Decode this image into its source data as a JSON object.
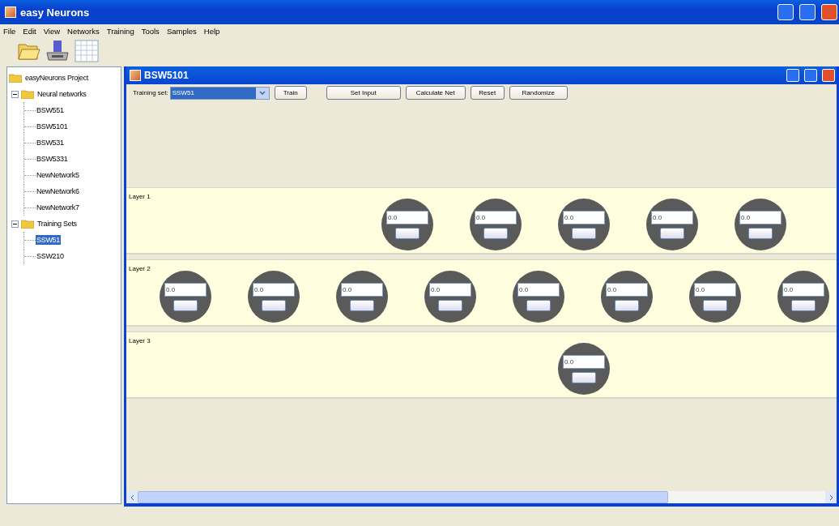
{
  "window": {
    "title": "easy Neurons"
  },
  "menu": [
    "File",
    "Edit",
    "View",
    "Networks",
    "Training",
    "Tools",
    "Samples",
    "Help"
  ],
  "toolbar": [
    {
      "kind": "open"
    },
    {
      "kind": "save"
    },
    {
      "kind": "table"
    }
  ],
  "tree": {
    "label": "easyNeurons Project",
    "children": [
      {
        "label": "Neural networks",
        "expanded": true,
        "selected": false,
        "children": [
          {
            "label": "BSW551",
            "selected": false
          },
          {
            "label": "BSW5101",
            "selected": false
          },
          {
            "label": "BSW531",
            "selected": false
          },
          {
            "label": "BSW5331",
            "selected": false
          },
          {
            "label": "NewNetwork5",
            "selected": false
          },
          {
            "label": "NewNetwork6",
            "selected": false
          },
          {
            "label": "NewNetwork7",
            "selected": false
          }
        ]
      },
      {
        "label": "Training Sets",
        "expanded": true,
        "selected": false,
        "children": [
          {
            "label": "SSW51",
            "selected": true
          },
          {
            "label": "SSW210",
            "selected": false
          }
        ]
      }
    ]
  },
  "frame": {
    "title": "BSW5101",
    "training_set_label": "Training set:",
    "training_set": "SSW51",
    "buttons": [
      "Train",
      "Set Input",
      "Calculate Net",
      "Reset",
      "Randomize"
    ],
    "layers": [
      {
        "label": "Layer 1",
        "neurons": [
          {
            "value": "0.0"
          },
          {
            "value": "0.0"
          },
          {
            "value": "0.0"
          },
          {
            "value": "0.0"
          },
          {
            "value": "0.0"
          }
        ]
      },
      {
        "label": "Layer 2",
        "neurons": [
          {
            "value": "0.0"
          },
          {
            "value": "0.0"
          },
          {
            "value": "0.0"
          },
          {
            "value": "0.0"
          },
          {
            "value": "0.0"
          },
          {
            "value": "0.0"
          },
          {
            "value": "0.0"
          },
          {
            "value": "0.0"
          }
        ]
      },
      {
        "label": "Layer 3",
        "neurons": [
          {
            "value": "0.0"
          }
        ]
      }
    ]
  }
}
